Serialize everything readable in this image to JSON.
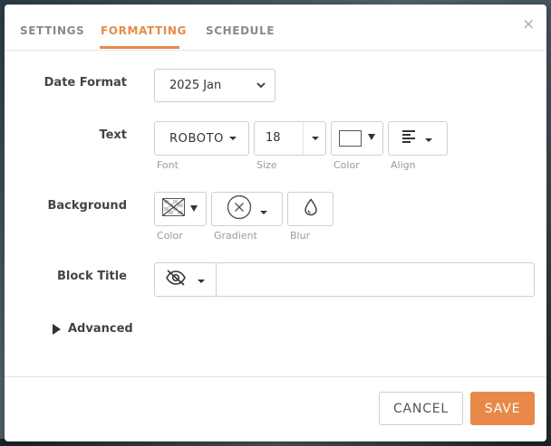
{
  "tabs": [
    {
      "label": "SETTINGS",
      "active": false
    },
    {
      "label": "FORMATTING",
      "active": true
    },
    {
      "label": "SCHEDULE",
      "active": false
    }
  ],
  "close_symbol": "×",
  "date_format": {
    "label": "Date Format",
    "value": "2025 Jan",
    "options": [
      "2025 Jan"
    ]
  },
  "text": {
    "label": "Text",
    "font": {
      "value": "ROBOTO",
      "sublabel": "Font"
    },
    "size": {
      "value": "18",
      "sublabel": "Size"
    },
    "color": {
      "value": "#ffffff",
      "sublabel": "Color"
    },
    "align": {
      "icon": "align-left-icon",
      "sublabel": "Align"
    }
  },
  "background": {
    "label": "Background",
    "color": {
      "icon": "no-color-icon",
      "sublabel": "Color"
    },
    "gradient": {
      "icon": "no-gradient-icon",
      "sublabel": "Gradient"
    },
    "blur": {
      "icon": "droplet-icon",
      "sublabel": "Blur"
    }
  },
  "block_title": {
    "label": "Block Title",
    "visibility_icon": "eye-off-icon",
    "value": ""
  },
  "advanced": {
    "label": "Advanced"
  },
  "buttons": {
    "cancel": "CANCEL",
    "save": "SAVE"
  },
  "colors": {
    "accent": "#e8894a",
    "text": "#444444",
    "muted": "#9a9a9a",
    "border": "#cfcfcf"
  }
}
